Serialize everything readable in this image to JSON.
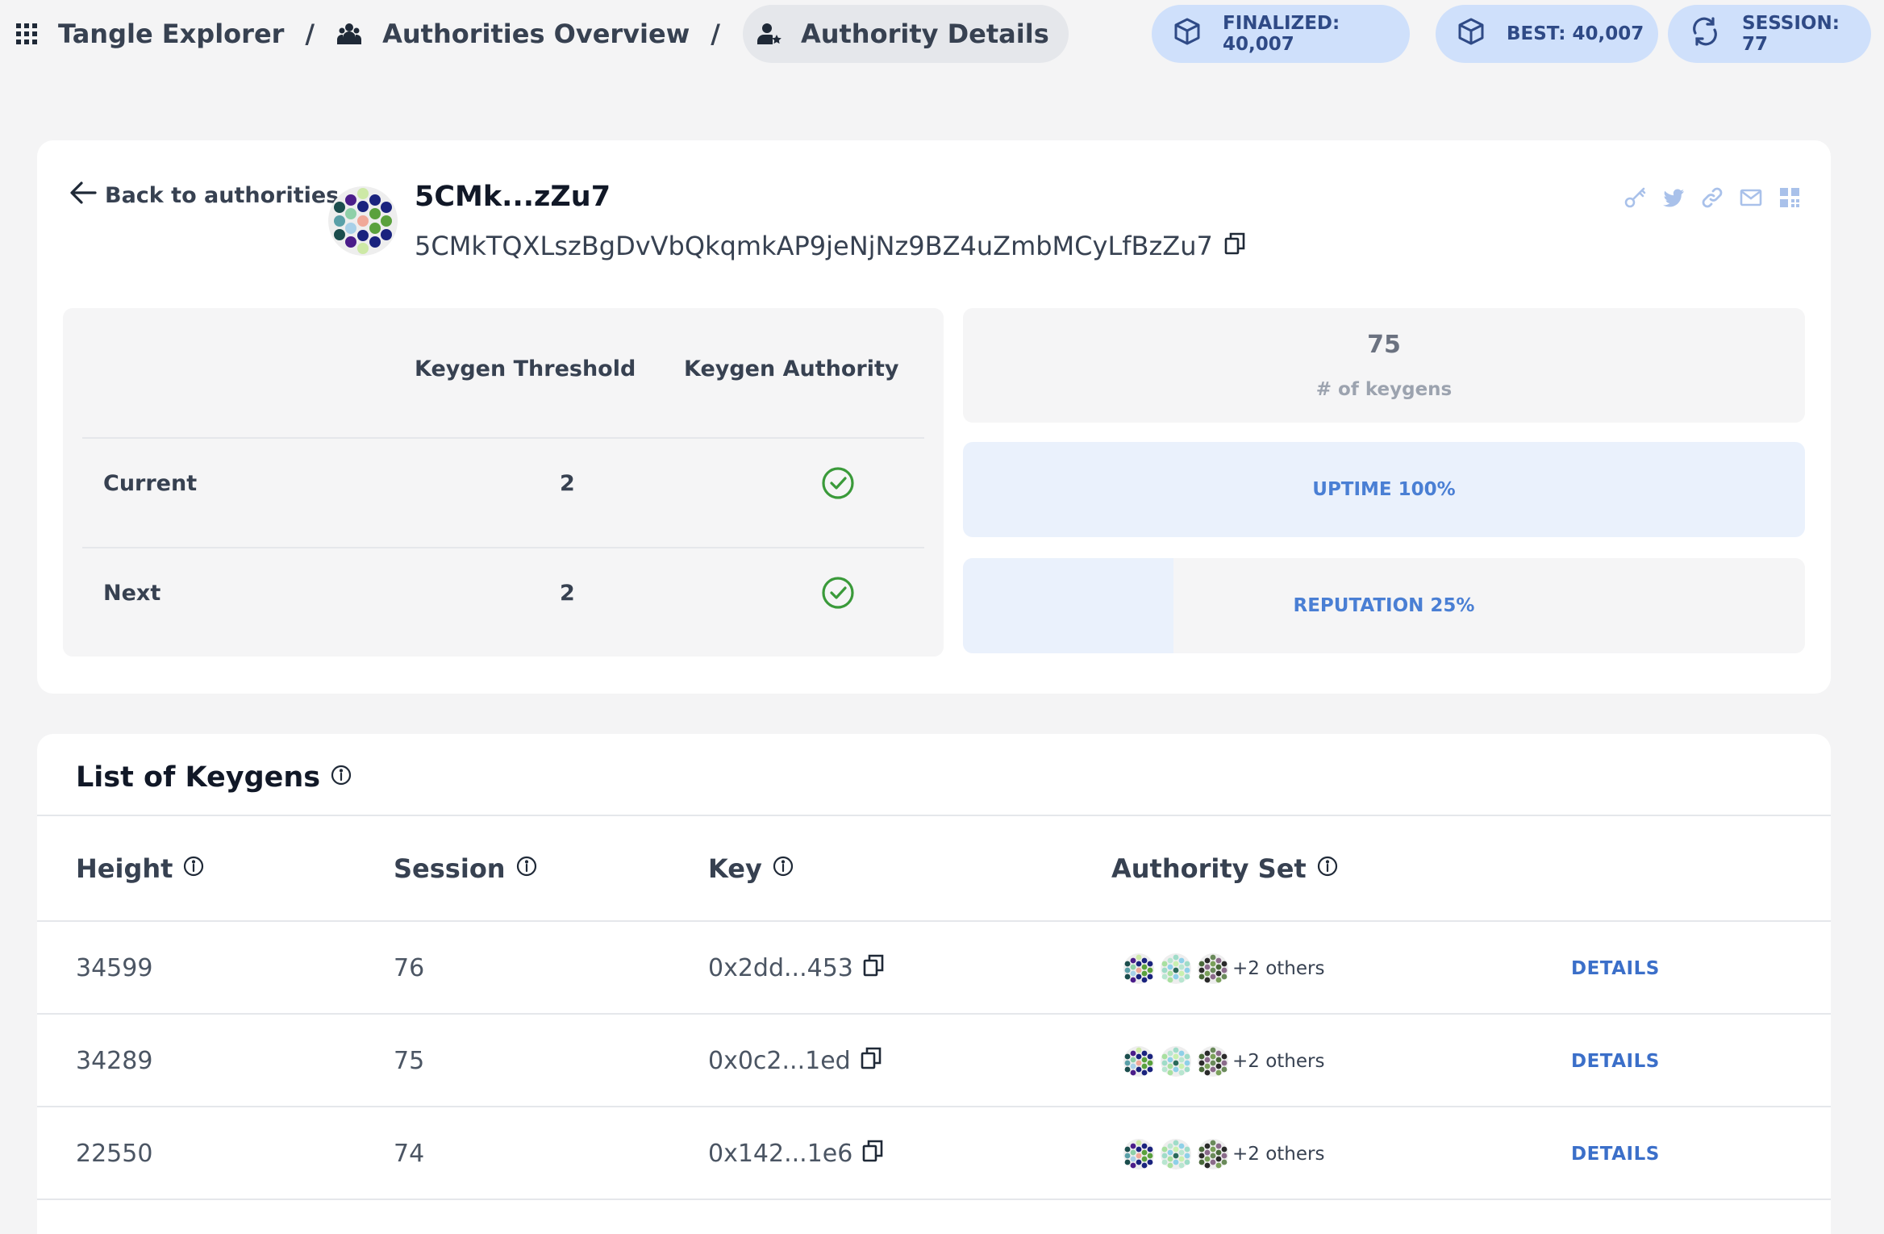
{
  "breadcrumbs": [
    {
      "label": "Tangle Explorer",
      "icon": "grid-icon"
    },
    {
      "label": "Authorities Overview",
      "icon": "users-icon"
    },
    {
      "label": "Authority Details",
      "icon": "user-star-icon"
    }
  ],
  "breadcrumb_separator": "/",
  "status": {
    "finalized": "FINALIZED: 40,007",
    "best": "BEST: 40,007",
    "session": "SESSION: 77"
  },
  "authority": {
    "back_label": "Back to authorities",
    "short_address": "5CMk...zZu7",
    "full_address": "5CMkTQXLszBgDvVbQkqmkAP9jeNjNz9BZ4uZmbMCyLfBzZu7"
  },
  "social_icons": [
    "key-icon",
    "twitter-icon",
    "link-icon",
    "mail-icon",
    "qr-icon"
  ],
  "keygen_table": {
    "headers": [
      "Keygen Threshold",
      "Keygen Authority"
    ],
    "rows": [
      {
        "label": "Current",
        "threshold": "2",
        "authority": true
      },
      {
        "label": "Next",
        "threshold": "2",
        "authority": true
      }
    ]
  },
  "stats": {
    "keygens_count": "75",
    "keygens_label": "# of keygens",
    "uptime_label": "UPTIME 100%",
    "uptime_fraction": 1.0,
    "reputation_label": "REPUTATION 25%",
    "reputation_fraction": 0.25
  },
  "keygens": {
    "title": "List of Keygens",
    "columns": [
      "Height",
      "Session",
      "Key",
      "Authority Set"
    ],
    "rows": [
      {
        "height": "34599",
        "session": "76",
        "key": "0x2dd...453",
        "others": "+2 others",
        "action": "DETAILS"
      },
      {
        "height": "34289",
        "session": "75",
        "key": "0x0c2...1ed",
        "others": "+2 others",
        "action": "DETAILS"
      },
      {
        "height": "22550",
        "session": "74",
        "key": "0x142...1e6",
        "others": "+2 others",
        "action": "DETAILS"
      }
    ]
  },
  "colors": {
    "accent": "#4a7fd4",
    "pill_bg": "#cfe0fb",
    "check_green": "#3a9a3a"
  }
}
